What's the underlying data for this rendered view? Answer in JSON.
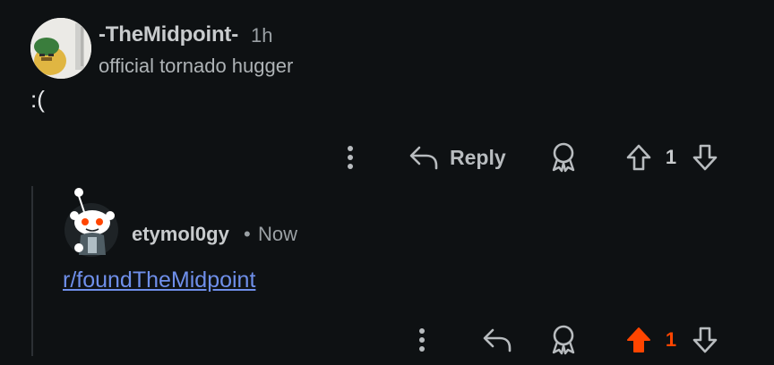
{
  "colors": {
    "background": "#0e1113",
    "text": "#d7dadc",
    "muted": "#9aa0a4",
    "link": "#6f8fea",
    "upvote_active": "#ff4500"
  },
  "comment": {
    "username": "-TheMidpoint-",
    "time": "1h",
    "flair": "official tornado hugger",
    "body": ":(",
    "actions": {
      "more_icon": "more-vertical-icon",
      "reply_label": "Reply",
      "award_icon": "award-icon",
      "vote_count": "1",
      "upvoted": false
    }
  },
  "reply": {
    "username": "etymol0gy",
    "separator": "•",
    "time": "Now",
    "body_link": "r/foundTheMidpoint",
    "actions": {
      "more_icon": "more-vertical-icon",
      "award_icon": "award-icon",
      "vote_count": "1",
      "upvoted": true
    }
  }
}
